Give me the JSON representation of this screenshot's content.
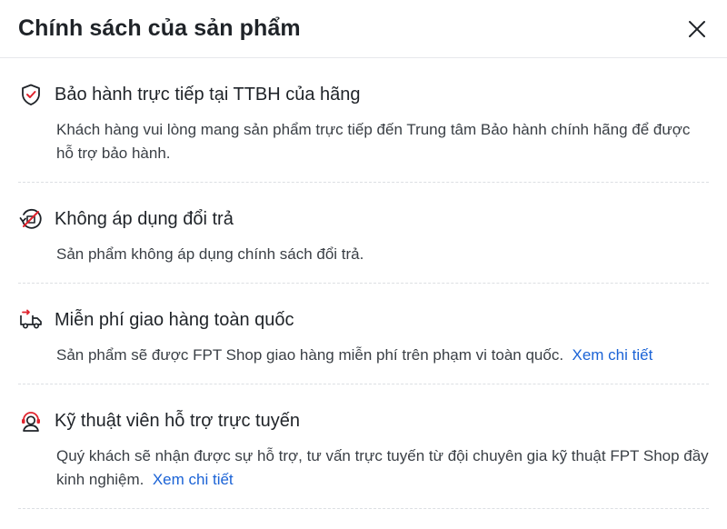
{
  "header": {
    "title": "Chính sách của sản phẩm",
    "close_icon": "close-icon"
  },
  "policies": [
    {
      "icon": "shield-check-icon",
      "title": "Bảo hành trực tiếp tại TTBH của hãng",
      "desc": "Khách hàng vui lòng mang sản phẩm trực tiếp đến Trung tâm Bảo hành chính hãng để được hỗ trợ bảo hành."
    },
    {
      "icon": "no-return-icon",
      "title": "Không áp dụng đổi trả",
      "desc": "Sản phẩm không áp dụng chính sách đổi trả."
    },
    {
      "icon": "delivery-truck-icon",
      "title": "Miễn phí giao hàng toàn quốc",
      "desc": "Sản phẩm sẽ được FPT Shop giao hàng miễn phí trên phạm vi toàn quốc.",
      "link": "Xem chi tiết"
    },
    {
      "icon": "support-agent-icon",
      "title": "Kỹ thuật viên hỗ trợ trực tuyến",
      "desc": "Quý khách sẽ nhận được sự hỗ trợ, tư vấn trực tuyến từ đội chuyên gia kỹ thuật FPT Shop đầy kinh nghiệm.",
      "link": "Xem chi tiết"
    }
  ],
  "colors": {
    "accent_red": "#e0232d",
    "link_blue": "#1b63d6",
    "text": "#1f2328"
  }
}
